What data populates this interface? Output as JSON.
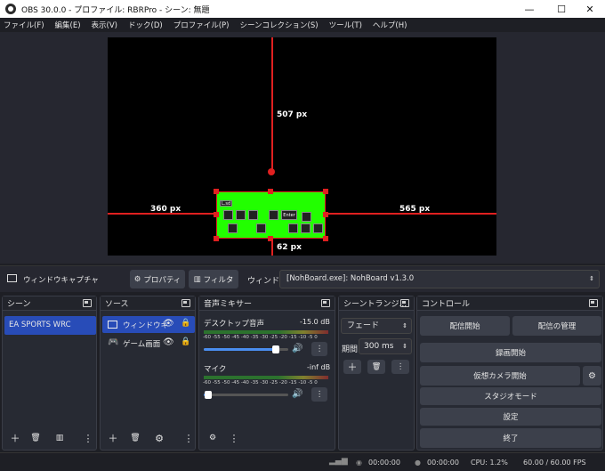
{
  "window": {
    "title": "OBS 30.0.0 - プロファイル: RBRPro - シーン: 無題",
    "minimize": "—",
    "maximize": "☐",
    "close": "✕"
  },
  "menu": [
    "ファイル(F)",
    "編集(E)",
    "表示(V)",
    "ドック(D)",
    "プロファイル(P)",
    "シーンコレクション(S)",
    "ツール(T)",
    "ヘルプ(H)"
  ],
  "preview": {
    "top_distance": "507 px",
    "left_distance": "360 px",
    "right_distance": "565 px",
    "bottom_distance": "62 px",
    "capture_keys": {
      "row1": [
        "L.sd",
        "",
        "",
        "",
        "",
        "",
        ""
      ],
      "labels": [
        "Enter"
      ]
    },
    "source_color": "#22ff00",
    "guide_color": "#e02020"
  },
  "source_toolbar": {
    "source_name": "ウィンドウキャプチャ",
    "properties": "プロパティ",
    "filters": "フィルタ",
    "window_label": "ウィンドウ",
    "window_value": "[NohBoard.exe]: NohBoard v1.3.0"
  },
  "scenes": {
    "title": "シーン",
    "items": [
      "EA SPORTS WRC"
    ]
  },
  "sources": {
    "title": "ソース",
    "items": [
      {
        "name": "ウィンドウキ",
        "icon": "window-icon"
      },
      {
        "name": "ゲーム画面",
        "icon": "gamepad-icon"
      }
    ]
  },
  "mixer": {
    "title": "音声ミキサー",
    "channels": [
      {
        "name": "デスクトップ音声",
        "level": "-15.0 dB",
        "volume_fraction": 0.85
      },
      {
        "name": "マイク",
        "level": "-inf dB",
        "volume_fraction": 0.05
      }
    ],
    "ticks": "-60 -55 -50 -45 -40 -35 -30 -25 -20 -15 -10 -5 0"
  },
  "transitions": {
    "title": "シーントランジ...",
    "type": "フェード",
    "duration_label": "期間",
    "duration_value": "300 ms"
  },
  "controls": {
    "title": "コントロール",
    "start_streaming": "配信開始",
    "manage_streaming": "配信の管理",
    "start_recording": "録画開始",
    "start_virtual_camera": "仮想カメラ開始",
    "studio_mode": "スタジオモード",
    "settings": "設定",
    "exit": "終了"
  },
  "status": {
    "stream_time": "00:00:00",
    "record_time": "00:00:00",
    "cpu": "CPU: 1.2%",
    "fps": "60.00 / 60.00 FPS"
  }
}
